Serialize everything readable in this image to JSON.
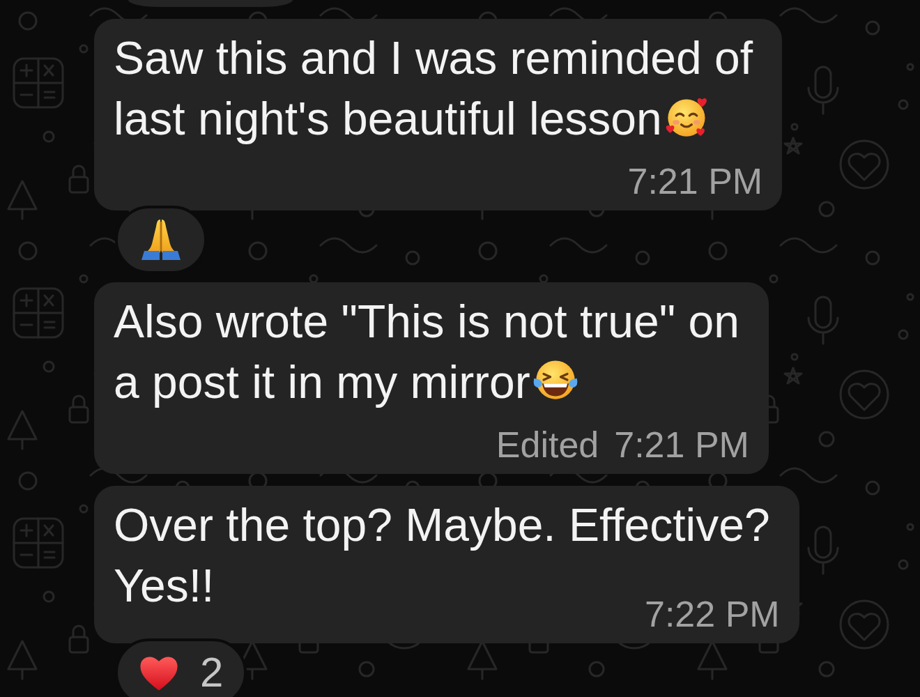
{
  "clipped_reaction_above": true,
  "messages": [
    {
      "lines": [
        "Saw this and I was reminded of",
        "last night's beautiful lesson"
      ],
      "emoji": {
        "kind": "smiling"
      },
      "time": "7:21 PM",
      "reaction": {
        "kind": "pray"
      }
    },
    {
      "lines": [
        "Also wrote \"This is not true\" on",
        "a post it in my mirror"
      ],
      "emoji": {
        "kind": "laughing"
      },
      "edited_label": "Edited",
      "time": "7:21 PM"
    },
    {
      "lines": [
        "Over the top? Maybe. Effective?",
        "Yes!!"
      ],
      "time": "7:22 PM",
      "reaction": {
        "kind": "heart",
        "count": "2"
      }
    }
  ]
}
